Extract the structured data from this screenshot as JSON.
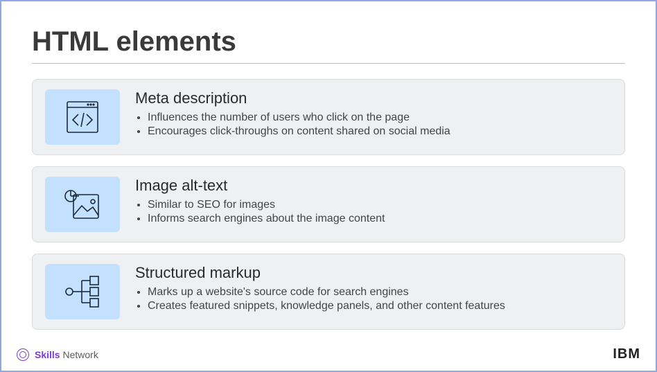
{
  "title": "HTML elements",
  "cards": [
    {
      "icon": "code-window-icon",
      "heading": "Meta description",
      "bullets": [
        "Influences the number of users who click on the page",
        "Encourages click-throughs on content shared on social media"
      ]
    },
    {
      "icon": "image-chart-icon",
      "heading": "Image alt-text",
      "bullets": [
        "Similar to SEO for images",
        "Informs search engines about the image content"
      ]
    },
    {
      "icon": "sitemap-icon",
      "heading": "Structured markup",
      "bullets": [
        "Marks up a website's source code for search engines",
        "Creates featured snippets, knowledge panels, and other content features"
      ]
    }
  ],
  "footer": {
    "skills_brand": "Skills",
    "skills_rest": " Network",
    "ibm": "IBM"
  }
}
